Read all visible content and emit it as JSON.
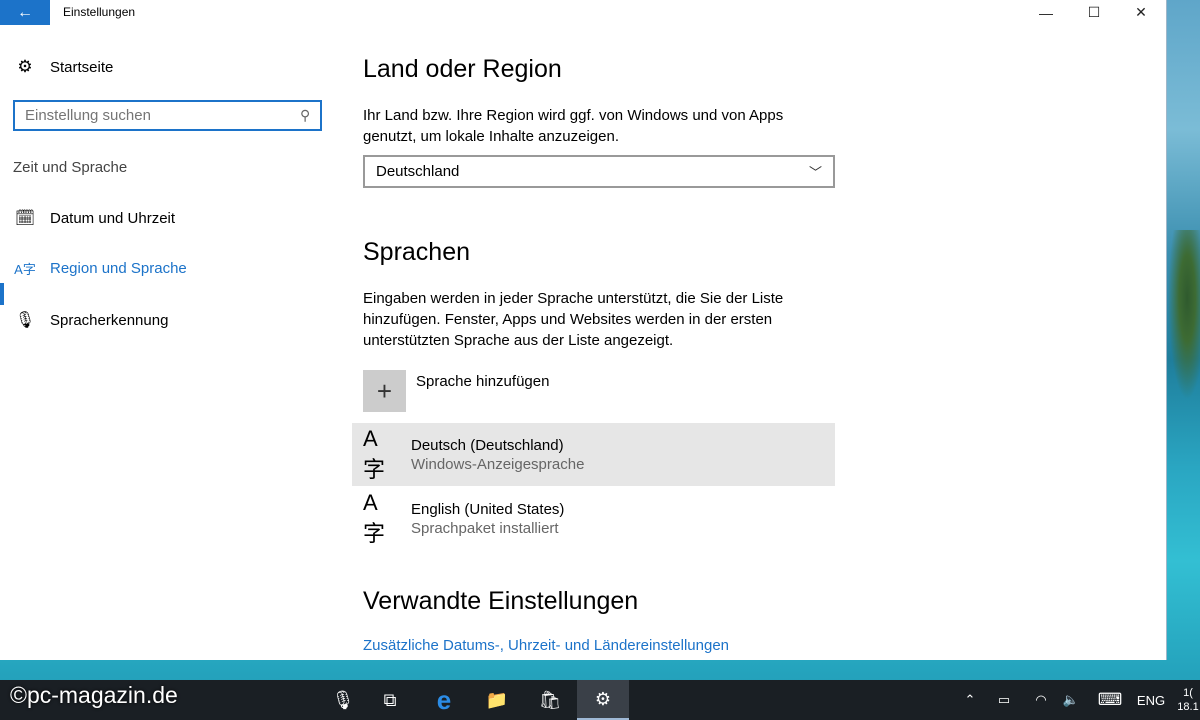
{
  "window": {
    "title": "Einstellungen",
    "back_icon": "←",
    "minimize_icon": "—",
    "maximize_icon": "☐",
    "close_icon": "✕"
  },
  "sidebar": {
    "home": {
      "icon": "gear-icon",
      "glyph": "⚙",
      "label": "Startseite"
    },
    "search": {
      "placeholder": "Einstellung suchen",
      "icon_glyph": "⚲"
    },
    "section": "Zeit und Sprache",
    "items": [
      {
        "label": "Datum und Uhrzeit",
        "glyph": "🗓",
        "active": false
      },
      {
        "label": "Region und Sprache",
        "glyph": "A字",
        "active": true
      },
      {
        "label": "Spracherkennung",
        "glyph": "🎙",
        "active": false
      }
    ]
  },
  "main": {
    "region": {
      "heading": "Land oder Region",
      "description_line1": "Ihr Land bzw. Ihre Region wird ggf. von Windows und von Apps",
      "description_line2": "genutzt, um lokale Inhalte anzuzeigen.",
      "selected": "Deutschland",
      "chevron": "﹀"
    },
    "languages": {
      "heading": "Sprachen",
      "description_line1": "Eingaben werden in jeder Sprache unterstützt, die Sie der Liste",
      "description_line2": "hinzufügen. Fenster, Apps und Websites werden in der ersten",
      "description_line3": "unterstützten Sprache aus der Liste angezeigt.",
      "add_label": "Sprache hinzufügen",
      "add_glyph": "+",
      "list": [
        {
          "name": "Deutsch (Deutschland)",
          "sub": "Windows-Anzeigesprache",
          "glyph": "A字",
          "selected": true
        },
        {
          "name": "English (United States)",
          "sub": "Sprachpaket installiert",
          "glyph": "A字",
          "selected": false
        }
      ]
    },
    "related": {
      "heading": "Verwandte Einstellungen",
      "link": "Zusätzliche Datums-, Uhrzeit- und Ländereinstellungen"
    }
  },
  "taskbar": {
    "watermark": "©pc-magazin.de",
    "mic_glyph": "🎙",
    "taskview_glyph": "⧉",
    "edge_glyph": "e",
    "explorer_glyph": "📁",
    "store_glyph": "🛍",
    "settings_glyph": "⚙",
    "tray_chevron": "⌃",
    "battery_glyph": "▭",
    "wifi_glyph": "◠",
    "volume_glyph": "🔈",
    "keyboard_glyph": "⌨",
    "lang": "ENG",
    "time": "1(",
    "date": "18.1"
  }
}
